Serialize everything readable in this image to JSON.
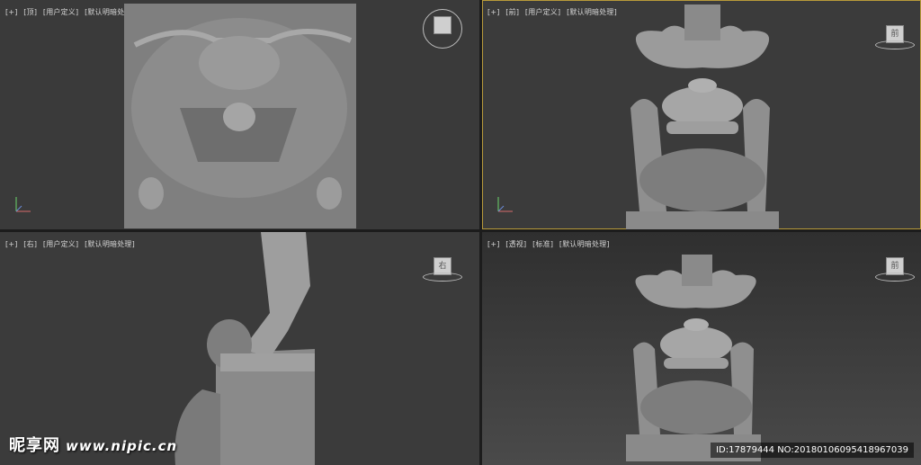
{
  "viewports": [
    {
      "id": "top",
      "labels": [
        "[+]",
        "[顶]",
        "[用户定义]",
        "[默认明暗处理]"
      ],
      "cube_text": ""
    },
    {
      "id": "front",
      "labels": [
        "[+]",
        "[前]",
        "[用户定义]",
        "[默认明暗处理]"
      ],
      "cube_text": "前"
    },
    {
      "id": "right",
      "labels": [
        "[+]",
        "[右]",
        "[用户定义]",
        "[默认明暗处理]"
      ],
      "cube_text": "右"
    },
    {
      "id": "perspective",
      "labels": [
        "[+]",
        "[透视]",
        "[标准]",
        "[默认明暗处理]"
      ],
      "cube_text": "前"
    }
  ],
  "watermark": {
    "brand": "昵享网",
    "site": "www.nipic.cn"
  },
  "id_text": "ID:17879444 NO:20180106095418967039",
  "colors": {
    "active_border": "#b89a3a",
    "model": "#8e8e8e",
    "viewport_bg": "#3b3b3b"
  }
}
